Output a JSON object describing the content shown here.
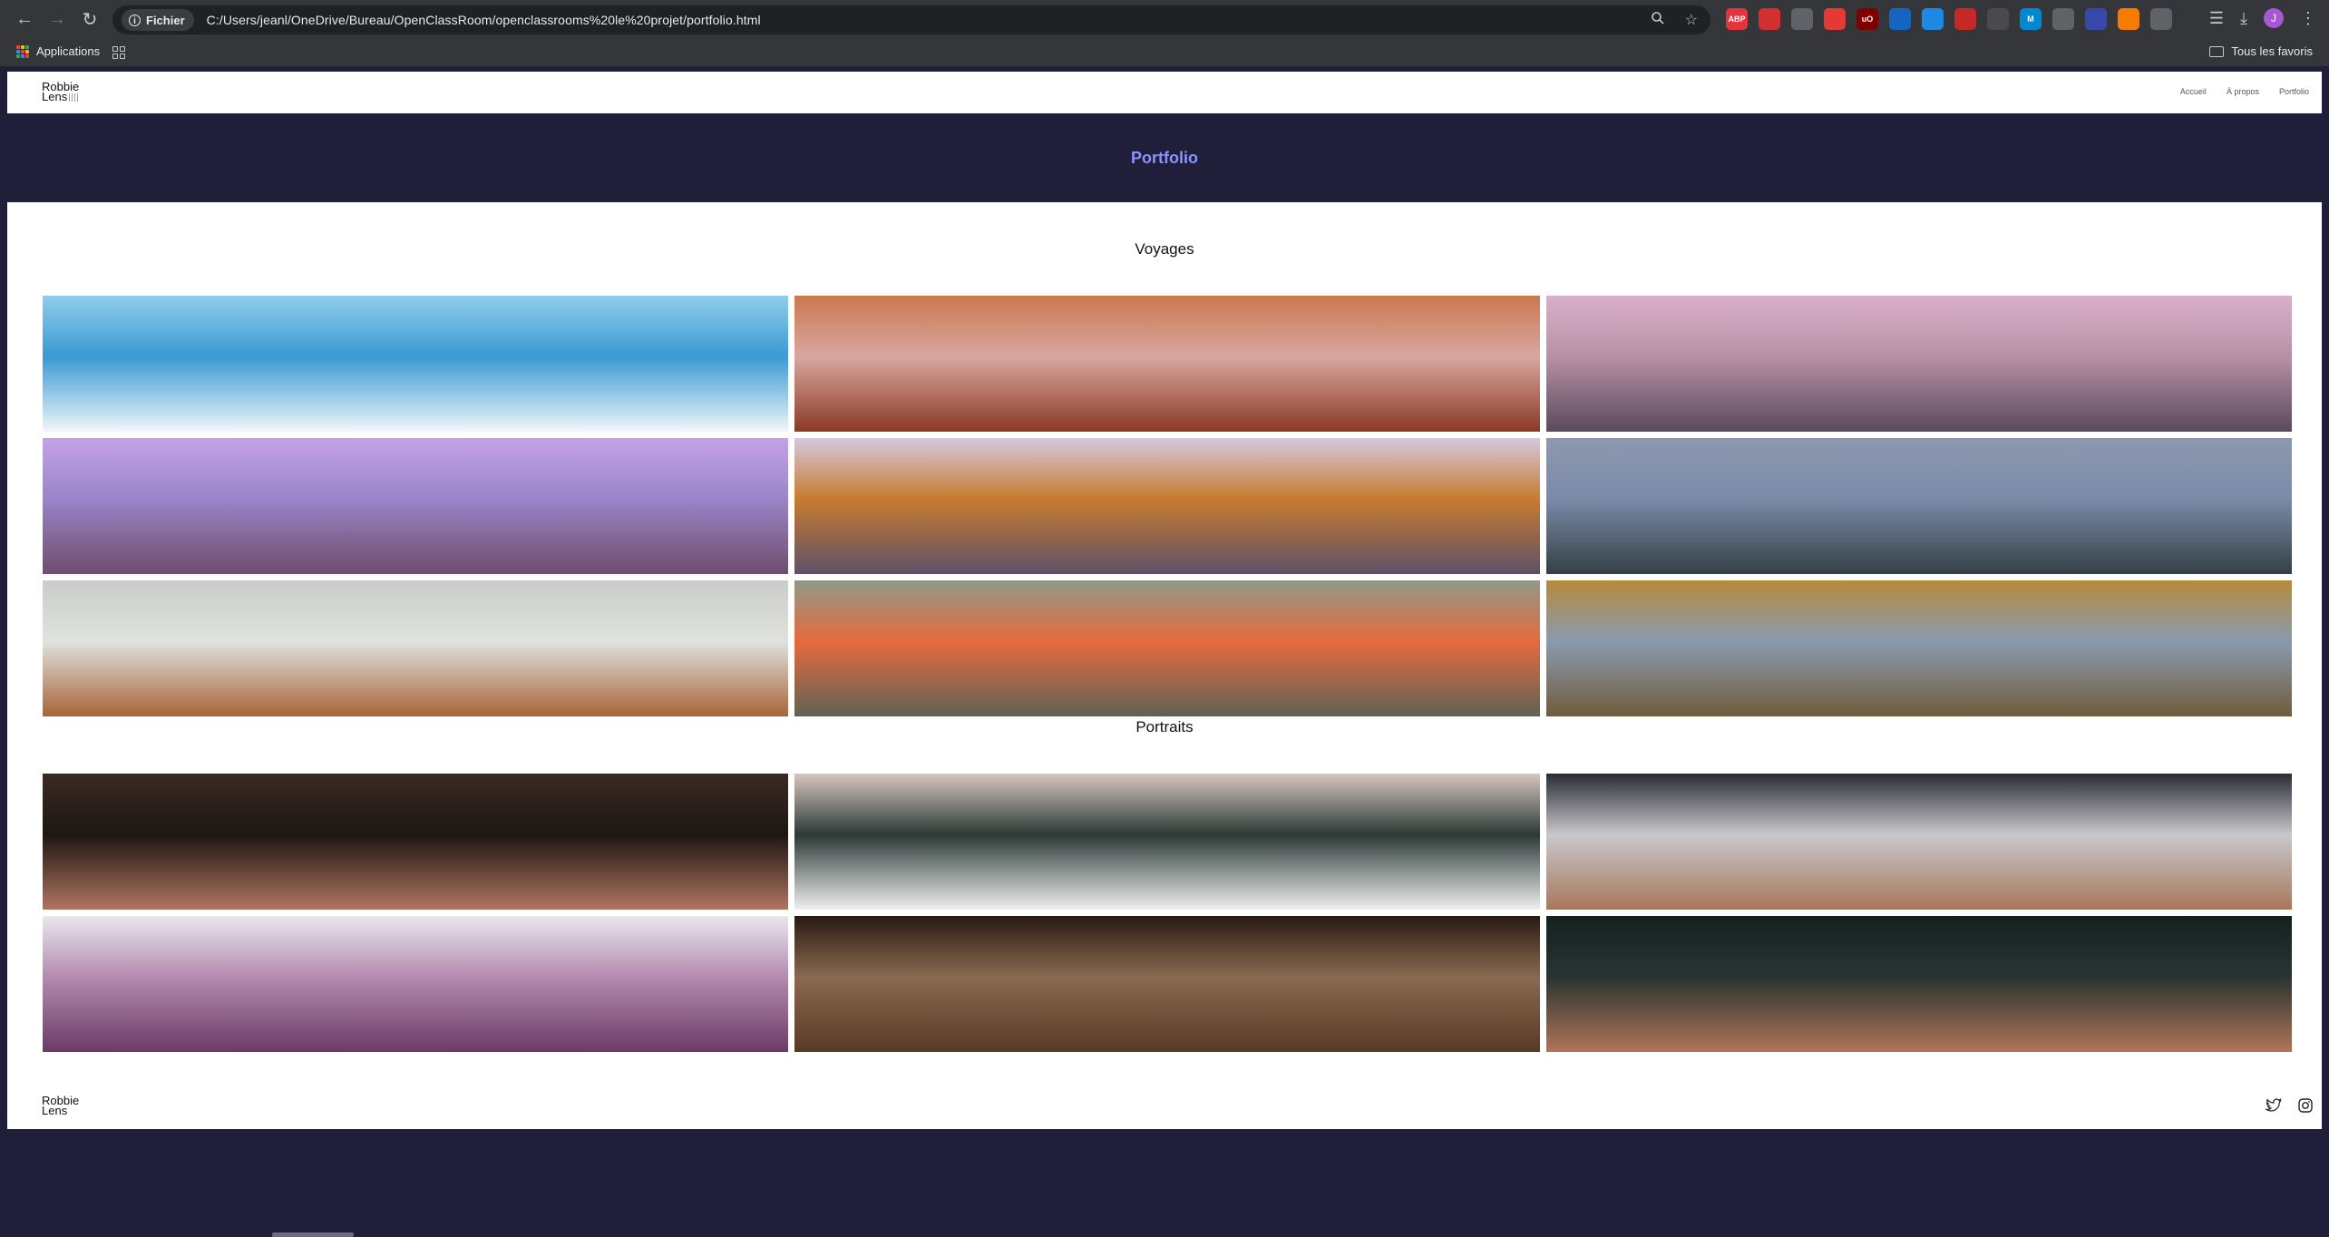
{
  "browser": {
    "security_chip": "Fichier",
    "url": "C:/Users/jeanl/OneDrive/Bureau/OpenClassRoom/openclassrooms%20le%20projet/portfolio.html",
    "profile_initial": "J",
    "extensions": [
      {
        "icon": "adblock-icon",
        "label": "ABP",
        "color": "#e3343b"
      },
      {
        "icon": "red-circle-extension-icon",
        "label": "",
        "color": "#d32f2f"
      },
      {
        "icon": "grid-extension-icon",
        "label": "",
        "color": "#5f6368"
      },
      {
        "icon": "red-play-extension-icon",
        "label": "",
        "color": "#e53935"
      },
      {
        "icon": "ublock-icon",
        "label": "uO",
        "color": "#800000"
      },
      {
        "icon": "blue-wave-extension-icon",
        "label": "",
        "color": "#1565c0"
      },
      {
        "icon": "blue-shield-extension-icon",
        "label": "",
        "color": "#1e88e5"
      },
      {
        "icon": "red-square-extension-icon",
        "label": "",
        "color": "#c62828"
      },
      {
        "icon": "gray-puzzle-extension-icon",
        "label": "",
        "color": "#4a4a4e"
      },
      {
        "icon": "m-extension-icon",
        "label": "M",
        "color": "#0288d1"
      },
      {
        "icon": "translate-extension-icon",
        "label": "",
        "color": "#5f6368"
      },
      {
        "icon": "person-extension-icon",
        "label": "",
        "color": "#3949ab"
      },
      {
        "icon": "orange-extension-icon",
        "label": "",
        "color": "#f57c00"
      },
      {
        "icon": "puzzle-icon",
        "label": "",
        "color": "#5f6368"
      }
    ]
  },
  "bookmarks": {
    "apps_label": "Applications",
    "all_bookmarks_label": "Tous les favoris"
  },
  "site": {
    "logo_line1": "Robbie",
    "logo_line2": "Lens",
    "nav": [
      "Accueil",
      "À propos",
      "Portfolio"
    ],
    "hero_title": "Portfolio",
    "sections": [
      {
        "title": "Voyages",
        "images": [
          {
            "name": "mountain-snow-peaks-image",
            "colors": [
              "#8fcdeb",
              "#f0f6fa",
              "#3a9ad3"
            ]
          },
          {
            "name": "red-desert-lake-image",
            "colors": [
              "#c9784e",
              "#8a3a24",
              "#d9a7a0"
            ]
          },
          {
            "name": "couple-on-pier-sunset-image",
            "colors": [
              "#d9b0c9",
              "#5a4a5c",
              "#b890a6"
            ]
          },
          {
            "name": "lone-tree-lake-purple-image",
            "colors": [
              "#c3a2e8",
              "#6e4d6e",
              "#9b84c8"
            ]
          },
          {
            "name": "volcano-sunrise-image",
            "colors": [
              "#d6c8e0",
              "#5e5068",
              "#c67b2e"
            ]
          },
          {
            "name": "fjord-reflection-image",
            "colors": [
              "#8d98b0",
              "#344044",
              "#7a8aa8"
            ]
          },
          {
            "name": "sea-stacks-coast-image",
            "colors": [
              "#c9ccc8",
              "#a86438",
              "#e0e2de"
            ]
          },
          {
            "name": "hot-spring-steam-image",
            "colors": [
              "#8f9a88",
              "#5c6453",
              "#e66a3e"
            ]
          },
          {
            "name": "mountain-lake-hut-image",
            "colors": [
              "#b58b3e",
              "#6f5c3c",
              "#8a9aae"
            ]
          }
        ]
      },
      {
        "title": "Portraits",
        "images": [
          {
            "name": "woman-lips-earring-portrait-image",
            "colors": [
              "#3a2a22",
              "#b07560",
              "#1e1712"
            ]
          },
          {
            "name": "man-white-tshirt-portrait-image",
            "colors": [
              "#d8c6c0",
              "#efefef",
              "#2b3a36"
            ]
          },
          {
            "name": "man-earring-hat-portrait-image",
            "colors": [
              "#2b2b35",
              "#a8775a",
              "#c8c8cc"
            ]
          },
          {
            "name": "purple-hair-portrait-image",
            "colors": [
              "#e8e8ec",
              "#6b3b66",
              "#b48ab0"
            ]
          },
          {
            "name": "woman-eyes-portrait-image",
            "colors": [
              "#2a1a12",
              "#5a3826",
              "#8a6a50"
            ]
          },
          {
            "name": "woman-lips-dark-portrait-image",
            "colors": [
              "#15211e",
              "#b07658",
              "#2a3432"
            ]
          }
        ]
      }
    ],
    "footer_logo_line1": "Robbie",
    "footer_logo_line2": "Lens"
  }
}
